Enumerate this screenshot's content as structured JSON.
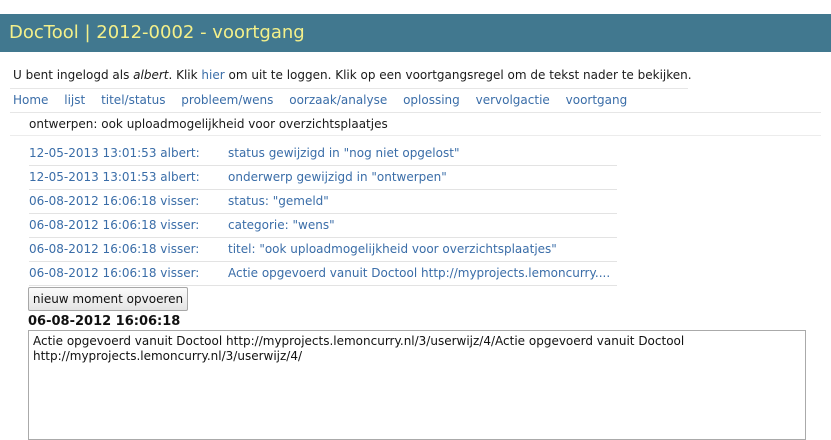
{
  "header": {
    "title": "DocTool | 2012-0002 - voortgang"
  },
  "login": {
    "prefix": "U bent ingelogd als ",
    "user": "albert",
    "mid": ". Klik ",
    "link": "hier",
    "suffix": " om uit te loggen. Klik op een voortgangsregel om de tekst nader te bekijken."
  },
  "nav": {
    "items": [
      "Home",
      "lijst",
      "titel/status",
      "probleem/wens",
      "oorzaak/analyse",
      "oplossing",
      "vervolgactie",
      "voortgang"
    ]
  },
  "subject": "ontwerpen: ook uploadmogelijkheid voor overzichtsplaatjes",
  "log": [
    {
      "who": "12-05-2013 13:01:53 albert:",
      "what": "status gewijzigd in \"nog niet opgelost\""
    },
    {
      "who": "12-05-2013 13:01:53 albert:",
      "what": "onderwerp gewijzigd in \"ontwerpen\""
    },
    {
      "who": "06-08-2012 16:06:18 visser:",
      "what": "status: \"gemeld\""
    },
    {
      "who": "06-08-2012 16:06:18 visser:",
      "what": "categorie: \"wens\""
    },
    {
      "who": "06-08-2012 16:06:18 visser:",
      "what": "titel: \"ook uploadmogelijkheid voor overzichtsplaatjes\""
    },
    {
      "who": "06-08-2012 16:06:18 visser:",
      "what": "Actie opgevoerd vanuit Doctool http://myprojects.lemoncurry...."
    }
  ],
  "button": {
    "new_moment": "nieuw moment opvoeren"
  },
  "detail": {
    "timestamp": "06-08-2012 16:06:18",
    "text": "Actie opgevoerd vanuit Doctool http://myprojects.lemoncurry.nl/3/userwijz/4/Actie opgevoerd vanuit Doctool\nhttp://myprojects.lemoncurry.nl/3/userwijz/4/"
  },
  "colors": {
    "titlebar": "#41788f",
    "title_text": "#f4f08a",
    "link": "#3a6da8"
  }
}
